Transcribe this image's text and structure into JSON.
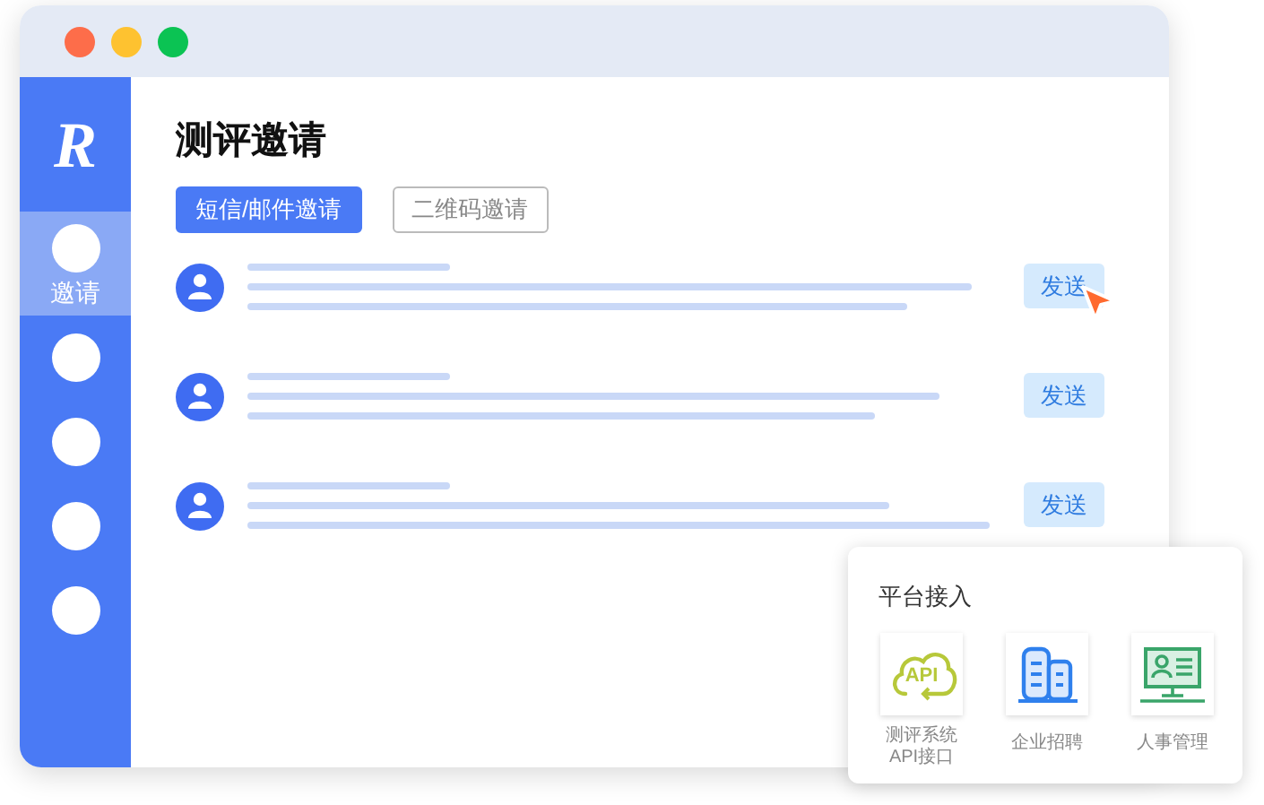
{
  "sidebar": {
    "logo": "R",
    "items": [
      {
        "label": "邀请",
        "selected": true
      },
      {
        "selected": false
      },
      {
        "selected": false
      },
      {
        "selected": false
      },
      {
        "selected": false
      }
    ]
  },
  "title": "测评邀请",
  "tabs": [
    {
      "label": "短信/邮件邀请",
      "selected": true
    },
    {
      "label": "二维码邀请",
      "selected": false
    }
  ],
  "rows": [
    {
      "button": "发送"
    },
    {
      "button": "发送"
    },
    {
      "button": "发送"
    }
  ],
  "platform": {
    "title": "平台接入",
    "items": [
      {
        "kind": "api",
        "icon_text": "API",
        "label": [
          "测评系统",
          "API接口"
        ]
      },
      {
        "kind": "building",
        "label": [
          "企业招聘"
        ]
      },
      {
        "kind": "monitor",
        "label": [
          "人事管理"
        ]
      }
    ]
  }
}
